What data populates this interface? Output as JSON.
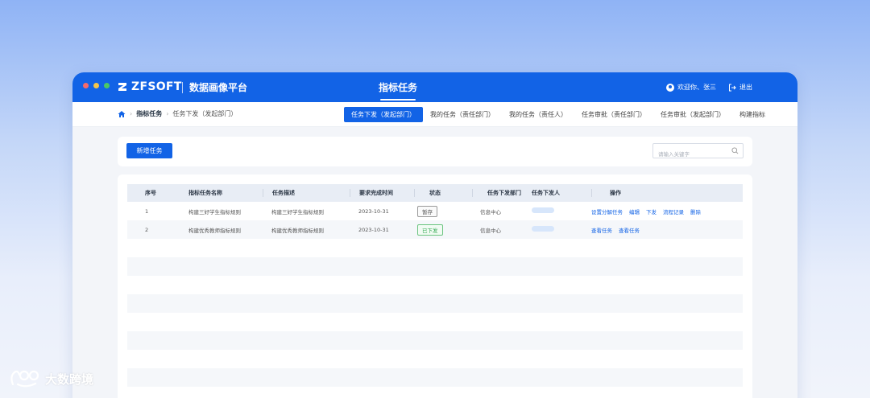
{
  "window": {
    "dots": [
      "#f56a6a",
      "#f5c64a",
      "#4cc764"
    ],
    "brand": "ZFSOFT",
    "platform": "数据画像平台",
    "center_title": "指标任务",
    "user_greeting": "欢迎你、张三",
    "logout": "退出"
  },
  "breadcrumb": {
    "items": [
      "指标任务",
      "任务下发（发起部门）"
    ]
  },
  "tabs": [
    {
      "label": "任务下发（发起部门）",
      "active": true
    },
    {
      "label": "我的任务（责任部门）",
      "active": false
    },
    {
      "label": "我的任务（责任人）",
      "active": false
    },
    {
      "label": "任务审批（责任部门）",
      "active": false
    },
    {
      "label": "任务审批（发起部门）",
      "active": false
    },
    {
      "label": "构建指标",
      "active": false
    }
  ],
  "toolbar": {
    "new_button": "新增任务",
    "search_placeholder": "请输入关键字"
  },
  "table": {
    "headers": [
      "序号",
      "指标任务名称",
      "任务描述",
      "要求完成时间",
      "状态",
      "任务下发部门",
      "任务下发人",
      "操作"
    ],
    "rows": [
      {
        "index": "1",
        "name": "构建三好学生指标规则",
        "desc": "构建三好学生指标规则",
        "due": "2023-10-31",
        "status": "暂存",
        "dept": "信息中心",
        "actions": [
          "设置分解任务",
          "编辑",
          "下发",
          "流程记录",
          "删除"
        ]
      },
      {
        "index": "2",
        "name": "构建优秀教师指标规则",
        "desc": "构建优秀教师指标规则",
        "due": "2023-10-31",
        "status": "已下发",
        "dept": "信息中心",
        "actions": [
          "查看任务",
          "查看任务"
        ]
      }
    ]
  },
  "watermark": "大数跨境",
  "colors": {
    "primary": "#1263e6",
    "status_sent": "#32a852"
  }
}
